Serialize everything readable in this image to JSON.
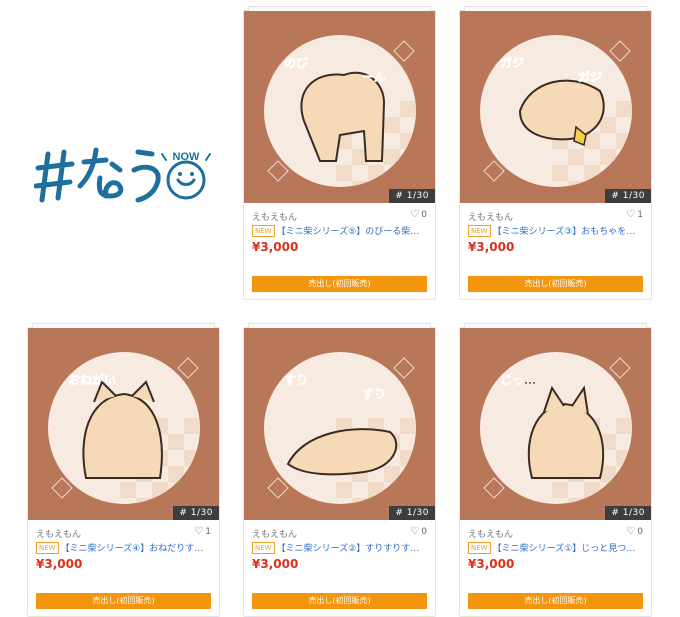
{
  "logo": {
    "main": "#なう",
    "small": "NOW"
  },
  "cards": [
    {
      "counter": "# 1/30",
      "seller": "えもえもん",
      "likes": "0",
      "badge": "NEW",
      "title": "【ミニ柴シリーズ⑤】のびーる柴…",
      "price": "¥3,000",
      "button": "売出し(初回販売)",
      "art_text": [
        "のび",
        "ーん"
      ]
    },
    {
      "counter": "# 1/30",
      "seller": "えもえもん",
      "likes": "1",
      "badge": "NEW",
      "title": "【ミニ柴シリーズ③】おもちゃを…",
      "price": "¥3,000",
      "button": "売出し(初回販売)",
      "art_text": [
        "ガジ",
        "ガジ"
      ]
    },
    {
      "counter": "# 1/30",
      "seller": "えもえもん",
      "likes": "1",
      "badge": "NEW",
      "title": "【ミニ柴シリーズ④】おねだりす…",
      "price": "¥3,000",
      "button": "売出し(初回販売)",
      "art_text": [
        "おねがい"
      ]
    },
    {
      "counter": "# 1/30",
      "seller": "えもえもん",
      "likes": "0",
      "badge": "NEW",
      "title": "【ミニ柴シリーズ②】すりすりす…",
      "price": "¥3,000",
      "button": "売出し(初回販売)",
      "art_text": [
        "すり",
        "すり"
      ]
    },
    {
      "counter": "# 1/30",
      "seller": "えもえもん",
      "likes": "0",
      "badge": "NEW",
      "title": "【ミニ柴シリーズ①】じっと見つ…",
      "price": "¥3,000",
      "button": "売出し(初回販売)",
      "art_text": [
        "じっ…"
      ]
    }
  ],
  "colors": {
    "art_bg": "#b9775a",
    "accent": "#f4950f",
    "price": "#d9311c",
    "link": "#2d6fc3",
    "logo": "#1f6f9e"
  }
}
